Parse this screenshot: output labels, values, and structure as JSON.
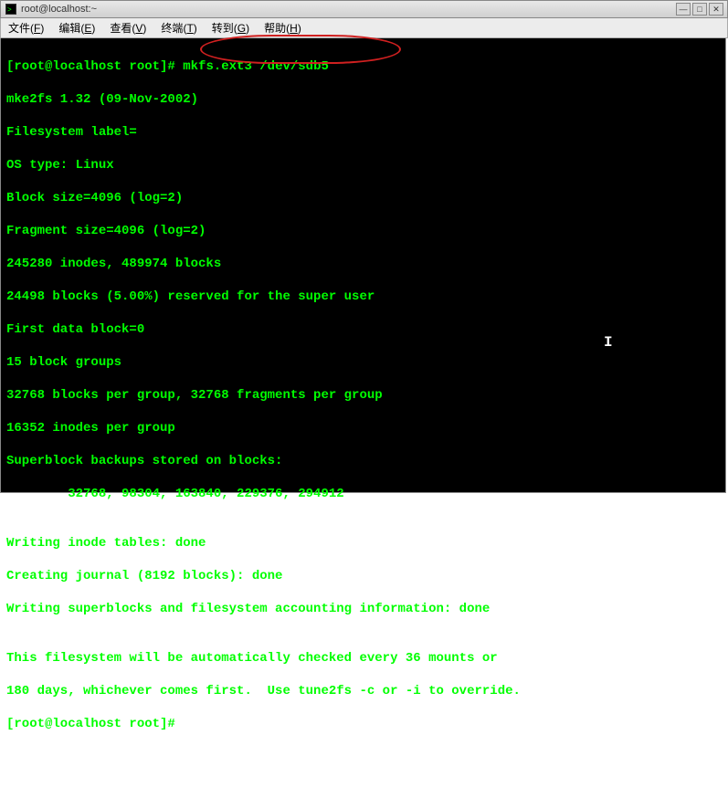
{
  "window": {
    "title": "root@localhost:~"
  },
  "menubar": {
    "items": [
      {
        "label": "文件",
        "accel": "F"
      },
      {
        "label": "编辑",
        "accel": "E"
      },
      {
        "label": "查看",
        "accel": "V"
      },
      {
        "label": "终端",
        "accel": "T"
      },
      {
        "label": "转到",
        "accel": "G"
      },
      {
        "label": "帮助",
        "accel": "H"
      }
    ]
  },
  "terminal": {
    "prompt": "[root@localhost root]#",
    "command": "mkfs.ext3 /dev/sdb5",
    "lines": [
      "mke2fs 1.32 (09-Nov-2002)",
      "Filesystem label=",
      "OS type: Linux",
      "Block size=4096 (log=2)",
      "Fragment size=4096 (log=2)",
      "245280 inodes, 489974 blocks",
      "24498 blocks (5.00%) reserved for the super user",
      "First data block=0",
      "15 block groups",
      "32768 blocks per group, 32768 fragments per group",
      "16352 inodes per group",
      "Superblock backups stored on blocks:",
      "        32768, 98304, 163840, 229376, 294912",
      "",
      "Writing inode tables: done",
      "Creating journal (8192 blocks): done",
      "Writing superblocks and filesystem accounting information: done",
      "",
      "This filesystem will be automatically checked every 36 mounts or",
      "180 days, whichever comes first.  Use tune2fs -c or -i to override."
    ],
    "prompt2": "[root@localhost root]#"
  }
}
